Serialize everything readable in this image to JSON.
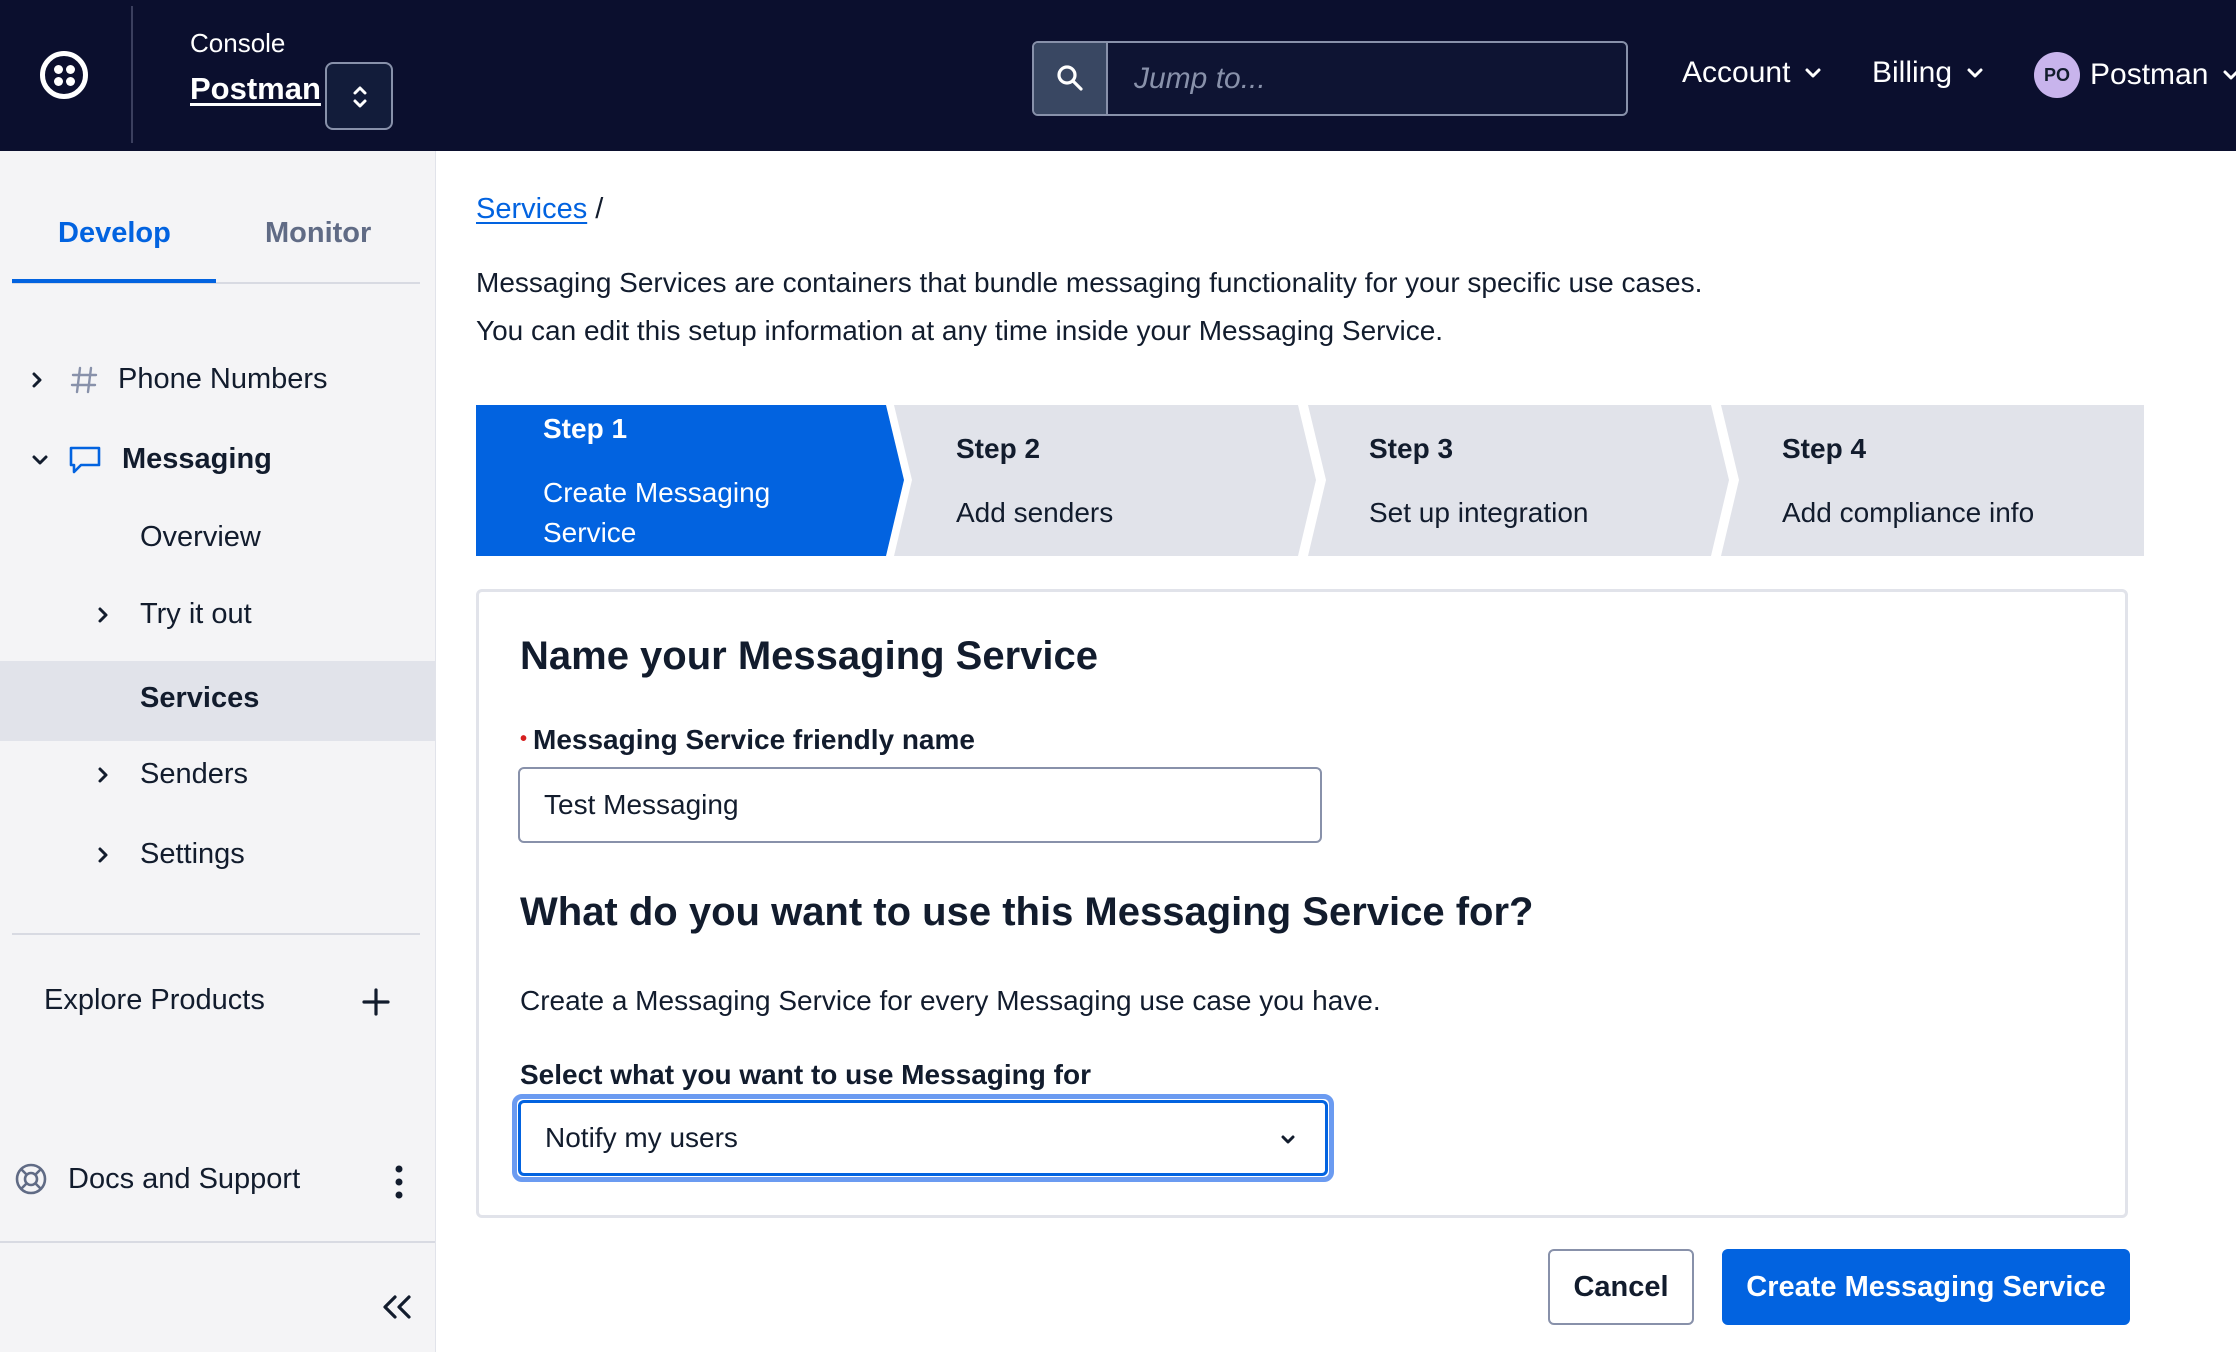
{
  "header": {
    "console_label": "Console",
    "account_name": "Postman",
    "search_placeholder": "Jump to...",
    "nav": {
      "account": "Account",
      "billing": "Billing",
      "user_initials": "PO",
      "user_name": "Postman"
    }
  },
  "sidebar": {
    "tabs": {
      "develop": "Develop",
      "monitor": "Monitor"
    },
    "items": {
      "phone_numbers": "Phone Numbers",
      "messaging": "Messaging",
      "overview": "Overview",
      "try_it_out": "Try it out",
      "services": "Services",
      "senders": "Senders",
      "settings": "Settings"
    },
    "explore_products": "Explore Products",
    "docs_support": "Docs and Support"
  },
  "breadcrumb": {
    "link": "Services",
    "separator": "/"
  },
  "intro": {
    "line1": "Messaging Services are containers that bundle messaging functionality for your specific use cases.",
    "line2": "You can edit this setup information at any time inside your Messaging Service."
  },
  "steps": [
    {
      "num": "Step 1",
      "label_line1": "Create Messaging",
      "label_line2": "Service",
      "active": true
    },
    {
      "num": "Step 2",
      "label": "Add senders",
      "active": false
    },
    {
      "num": "Step 3",
      "label": "Set up integration",
      "active": false
    },
    {
      "num": "Step 4",
      "label": "Add compliance info",
      "active": false
    }
  ],
  "form": {
    "heading1": "Name your Messaging Service",
    "name_label": "Messaging Service friendly name",
    "required_marker": "•",
    "name_value": "Test Messaging",
    "heading2": "What do you want to use this Messaging Service for?",
    "description": "Create a Messaging Service for every Messaging use case you have.",
    "select_label": "Select what you want to use Messaging for",
    "select_value": "Notify my users"
  },
  "actions": {
    "cancel": "Cancel",
    "create": "Create Messaging Service"
  },
  "colors": {
    "topbar": "#0b0f2e",
    "primary": "#0263e0",
    "step_inactive": "#e1e3ea",
    "sidebar_bg": "#f4f4f6"
  }
}
